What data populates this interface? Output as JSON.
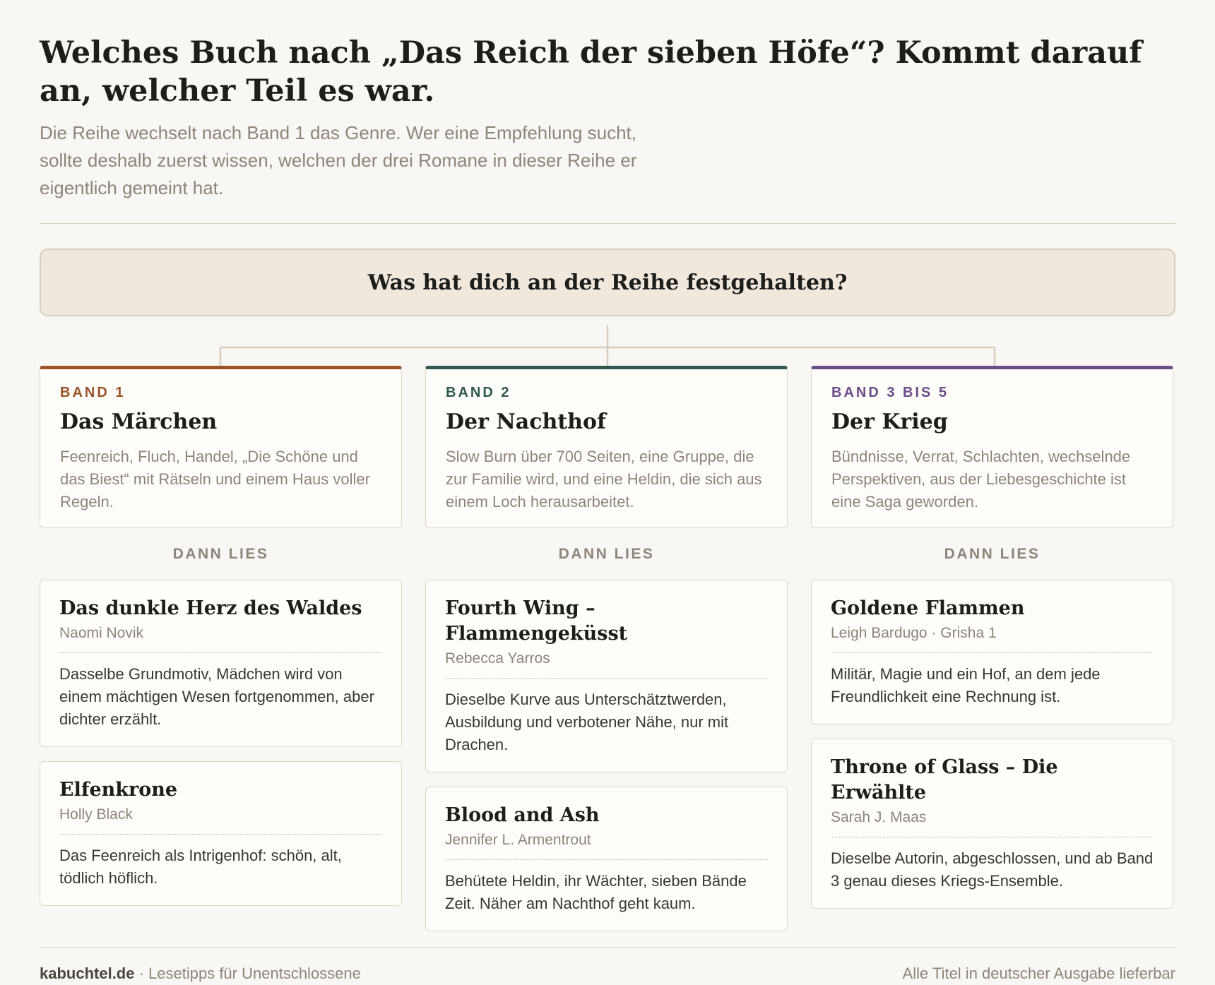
{
  "header": {
    "title": "Welches Buch nach „Das Reich der sieben Höfe“? Kommt darauf an, welcher Teil es war.",
    "intro": "Die Reihe wechselt nach Band 1 das Genre. Wer eine Empfehlung sucht, sollte deshalb zuerst wissen, welchen der drei Romane in dieser Reihe er eigentlich gemeint hat."
  },
  "question": "Was hat dich an der Reihe festgehalten?",
  "colors": {
    "band1": "#9c5328",
    "band2": "#2f5a4d",
    "band3": "#6b4d8c",
    "connector": "#d6ccbd"
  },
  "columns": [
    {
      "band_label": "BAND 1",
      "band_title": "Das Märchen",
      "band_desc": "Feenreich, Fluch, Handel, „Die Schöne und das Biest“ mit Rätseln und einem Haus voller Regeln.",
      "then_label": "DANN LIES",
      "books": [
        {
          "title": "Das dunkle Herz des Waldes",
          "author": "Naomi Novik",
          "note": "Dasselbe Grundmotiv, Mädchen wird von einem mächtigen Wesen fortgenommen, aber dichter erzählt."
        },
        {
          "title": "Elfenkrone",
          "author": "Holly Black",
          "note": "Das Feenreich als Intrigenhof: schön, alt, tödlich höflich."
        }
      ]
    },
    {
      "band_label": "BAND 2",
      "band_title": "Der Nachthof",
      "band_desc": "Slow Burn über 700 Seiten, eine Gruppe, die zur Familie wird, und eine Heldin, die sich aus einem Loch herausarbeitet.",
      "then_label": "DANN LIES",
      "books": [
        {
          "title": "Fourth Wing – Flammengeküsst",
          "author": "Rebecca Yarros",
          "note": "Dieselbe Kurve aus Unterschätztwerden, Ausbildung und verbotener Nähe, nur mit Drachen."
        },
        {
          "title": "Blood and Ash",
          "author": "Jennifer L. Armentrout",
          "note": "Behütete Heldin, ihr Wächter, sieben Bände Zeit. Näher am Nachthof geht kaum."
        }
      ]
    },
    {
      "band_label": "BAND 3 BIS 5",
      "band_title": "Der Krieg",
      "band_desc": "Bündnisse, Verrat, Schlachten, wechselnde Perspektiven, aus der Liebesgeschichte ist eine Saga geworden.",
      "then_label": "DANN LIES",
      "books": [
        {
          "title": "Goldene Flammen",
          "author": "Leigh Bardugo · Grisha 1",
          "note": "Militär, Magie und ein Hof, an dem jede Freundlichkeit eine Rechnung ist."
        },
        {
          "title": "Throne of Glass – Die Erwählte",
          "author": "Sarah J. Maas",
          "note": "Dieselbe Autorin, abgeschlossen, und ab Band 3 genau dieses Kriegs-Ensemble."
        }
      ]
    }
  ],
  "footer": {
    "site": "kabuchtel.de",
    "tagline": " · Lesetipps für Unentschlossene",
    "note": "Alle Titel in deutscher Ausgabe lieferbar"
  }
}
